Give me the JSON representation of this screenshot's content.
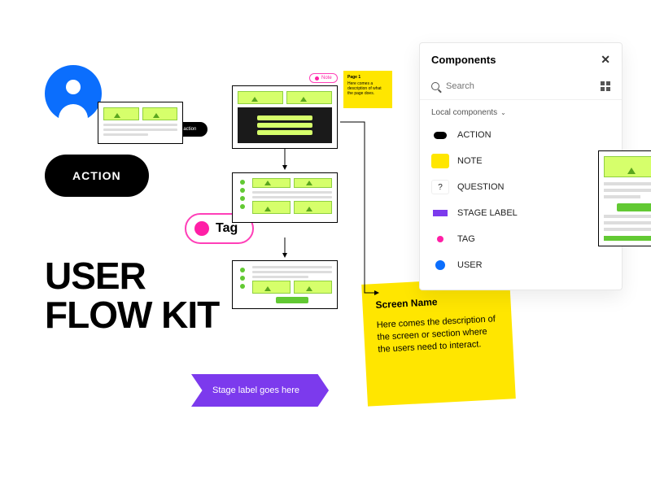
{
  "headline": {
    "line1": "USER",
    "line2": "FLOW KIT"
  },
  "action_pill": "ACTION",
  "connector_label": "some action",
  "tag_pill": "Tag",
  "stage_flag": "Stage label goes here",
  "mini_note": {
    "title": "Page 1",
    "body": "Here comes a description of what the page does."
  },
  "note_chip": "Note",
  "sticky": {
    "title": "Screen Name",
    "body": "Here comes the description of the screen or section where the users need to interact."
  },
  "panel": {
    "title": "Components",
    "search_placeholder": "Search",
    "group_label": "Local components",
    "items": [
      {
        "label": "ACTION",
        "icon": "action"
      },
      {
        "label": "NOTE",
        "icon": "note"
      },
      {
        "label": "QUESTION",
        "icon": "question"
      },
      {
        "label": "STAGE LABEL",
        "icon": "stage"
      },
      {
        "label": "TAG",
        "icon": "tag"
      },
      {
        "label": "USER",
        "icon": "user"
      }
    ]
  }
}
